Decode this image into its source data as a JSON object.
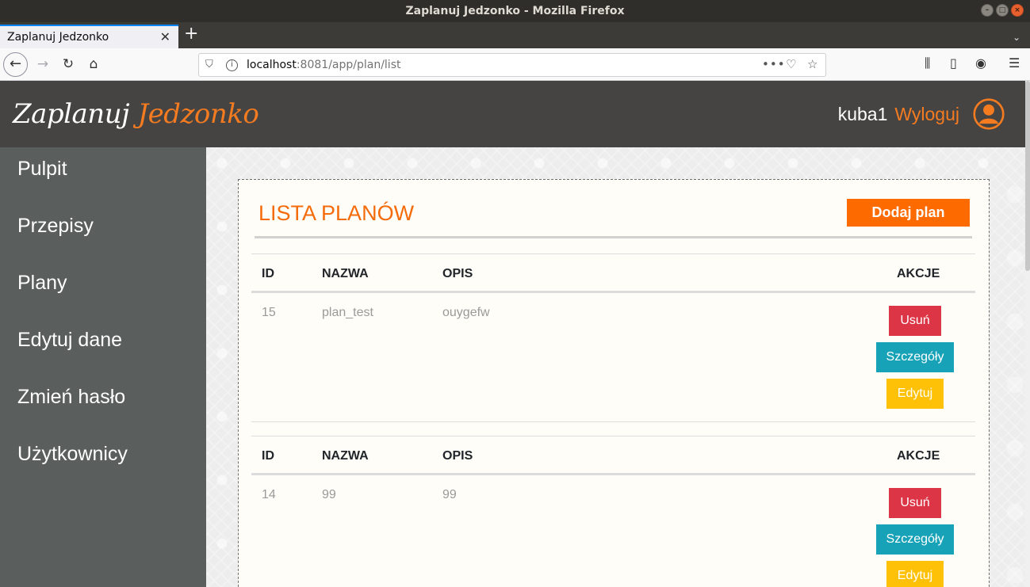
{
  "window": {
    "title": "Zaplanuj Jedzonko - Mozilla Firefox"
  },
  "browser": {
    "tab_title": "Zaplanuj Jedzonko",
    "url_host": "localhost",
    "url_rest": ":8081/app/plan/list"
  },
  "app": {
    "logo_main": "Zaplanuj",
    "logo_accent": "Jedzonko",
    "username": "kuba1",
    "logout_label": "Wyloguj",
    "accent_color": "#f47b20"
  },
  "sidebar": {
    "items": [
      {
        "label": "Pulpit"
      },
      {
        "label": "Przepisy"
      },
      {
        "label": "Plany"
      },
      {
        "label": "Edytuj dane"
      },
      {
        "label": "Zmień hasło"
      },
      {
        "label": "Użytkownicy"
      }
    ]
  },
  "main": {
    "title": "LISTA PLANÓW",
    "add_button": "Dodaj plan",
    "columns": {
      "id": "ID",
      "name": "NAZWA",
      "desc": "OPIS",
      "actions": "AKCJE"
    },
    "plans": [
      {
        "id": "15",
        "name": "plan_test",
        "desc": "ouygefw",
        "delete": "Usuń",
        "details": "Szczegóły",
        "edit": "Edytuj"
      },
      {
        "id": "14",
        "name": "99",
        "desc": "99",
        "delete": "Usuń",
        "details": "Szczegóły",
        "edit": "Edytuj"
      }
    ]
  }
}
